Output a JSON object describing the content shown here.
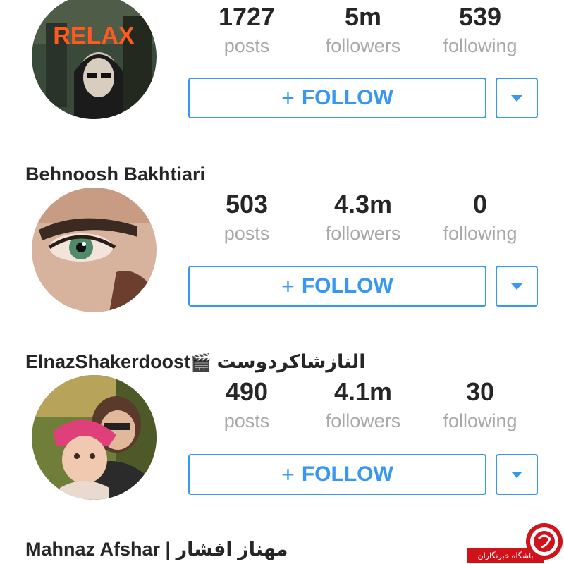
{
  "profiles": [
    {
      "name": "",
      "stats": {
        "posts": "1727",
        "followers": "5m",
        "following": "539"
      },
      "avatar_text": "RELAX"
    },
    {
      "name": "Behnoosh Bakhtiari",
      "stats": {
        "posts": "503",
        "followers": "4.3m",
        "following": "0"
      }
    },
    {
      "name": "ElnazShakerdoost",
      "name_suffix": "النازشاکردوست",
      "stats": {
        "posts": "490",
        "followers": "4.1m",
        "following": "30"
      }
    },
    {
      "name": "Mahnaz Afshar | مهناز افشار"
    }
  ],
  "labels": {
    "posts": "posts",
    "followers": "followers",
    "following": "following"
  },
  "button": {
    "plus": "+",
    "follow": "FOLLOW"
  },
  "watermark": {
    "text": "باشگاه خبرنگاران"
  },
  "colors": {
    "accent": "#3897f0",
    "muted": "#a8a8a8",
    "text": "#262626",
    "watermark": "#d0121b"
  }
}
